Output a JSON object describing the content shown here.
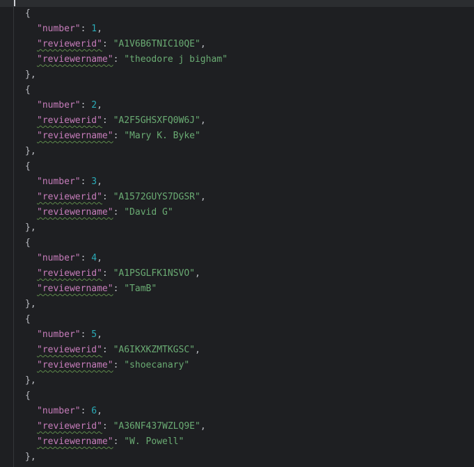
{
  "editor": {
    "open_brace": "{",
    "close_brace": "},",
    "colon": ": ",
    "comma": ",",
    "keys": {
      "number": "\"number\"",
      "reviewerid": "\"reviewerid\"",
      "reviewername": "\"reviewername\""
    },
    "records": [
      {
        "number": "1",
        "reviewerid": "\"A1V6B6TNIC10QE\"",
        "reviewername": "\"theodore j bigham\""
      },
      {
        "number": "2",
        "reviewerid": "\"A2F5GHSXFQ0W6J\"",
        "reviewername": "\"Mary K. Byke\""
      },
      {
        "number": "3",
        "reviewerid": "\"A1572GUYS7DGSR\"",
        "reviewername": "\"David G\""
      },
      {
        "number": "4",
        "reviewerid": "\"A1PSGLFK1NSVO\"",
        "reviewername": "\"TamB\""
      },
      {
        "number": "5",
        "reviewerid": "\"A6IKXKZMTKGSC\"",
        "reviewername": "\"shoecanary\""
      },
      {
        "number": "6",
        "reviewerid": "\"A36NF437WZLQ9E\"",
        "reviewername": "\"W. Powell\""
      }
    ]
  },
  "colors": {
    "background": "#1e1f22",
    "key": "#c77dbb",
    "number": "#2aacb8",
    "string": "#6aab73",
    "punctuation": "#bcbec4",
    "typo_underline": "#5d8a4a"
  }
}
